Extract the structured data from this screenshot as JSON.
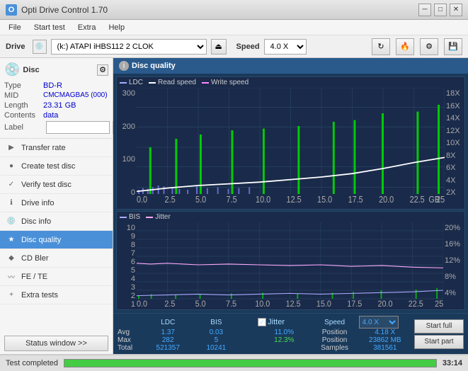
{
  "app": {
    "title": "Opti Drive Control 1.70",
    "titlebar_icon": "O"
  },
  "menubar": {
    "items": [
      "File",
      "Start test",
      "Extra",
      "Help"
    ]
  },
  "drive_toolbar": {
    "label": "Drive",
    "drive_value": "(k:) ATAPI iHBS112  2 CLOK",
    "speed_label": "Speed",
    "speed_value": "4.0 X"
  },
  "disc": {
    "title": "Disc",
    "type_label": "Type",
    "type_value": "BD-R",
    "mid_label": "MID",
    "mid_value": "CMCMAGBA5 (000)",
    "length_label": "Length",
    "length_value": "23.31 GB",
    "contents_label": "Contents",
    "contents_value": "data",
    "label_label": "Label"
  },
  "nav": {
    "items": [
      {
        "id": "transfer-rate",
        "label": "Transfer rate",
        "icon": "▶"
      },
      {
        "id": "create-test-disc",
        "label": "Create test disc",
        "icon": "●"
      },
      {
        "id": "verify-test-disc",
        "label": "Verify test disc",
        "icon": "✓"
      },
      {
        "id": "drive-info",
        "label": "Drive info",
        "icon": "ℹ"
      },
      {
        "id": "disc-info",
        "label": "Disc info",
        "icon": "💿"
      },
      {
        "id": "disc-quality",
        "label": "Disc quality",
        "icon": "★",
        "active": true
      },
      {
        "id": "cd-bler",
        "label": "CD Bler",
        "icon": "◆"
      },
      {
        "id": "fe-te",
        "label": "FE / TE",
        "icon": "~"
      },
      {
        "id": "extra-tests",
        "label": "Extra tests",
        "icon": "+"
      }
    ],
    "status_btn": "Status window >>"
  },
  "chart": {
    "title": "Disc quality",
    "legend_top": {
      "ldc": "LDC",
      "read": "Read speed",
      "write": "Write speed"
    },
    "legend_bottom": {
      "bis": "BIS",
      "jitter": "Jitter"
    },
    "x_labels": [
      "0.0",
      "2.5",
      "5.0",
      "7.5",
      "10.0",
      "12.5",
      "15.0",
      "17.5",
      "20.0",
      "22.5",
      "25.0"
    ],
    "top_y_left": [
      "300",
      "200",
      "100",
      "0"
    ],
    "top_y_right": [
      "18X",
      "16X",
      "14X",
      "12X",
      "10X",
      "8X",
      "6X",
      "4X",
      "2X"
    ],
    "bottom_y_left": [
      "10",
      "9",
      "8",
      "7",
      "6",
      "5",
      "4",
      "3",
      "2",
      "1"
    ],
    "bottom_y_right": [
      "20%",
      "16%",
      "12%",
      "8%",
      "4%"
    ]
  },
  "stats": {
    "headers": [
      "LDC",
      "BIS",
      "",
      "Jitter",
      "Speed",
      ""
    ],
    "rows": [
      {
        "label": "Avg",
        "ldc": "1.37",
        "bis": "0.03",
        "jitter": "11.0%",
        "speed_label": "Position",
        "speed_val": "4.18 X",
        "speed_select": "4.0 X"
      },
      {
        "label": "Max",
        "ldc": "282",
        "bis": "5",
        "jitter": "12.3%",
        "speed_label": "Position",
        "speed_val": "23862 MB"
      },
      {
        "label": "Total",
        "ldc": "521357",
        "bis": "10241",
        "speed_label": "Samples",
        "speed_val": "381561"
      }
    ],
    "jitter_checked": true,
    "jitter_label": "Jitter",
    "speed_val": "4.18 X",
    "speed_select": "4.0 X",
    "position_label": "Position",
    "position_val": "23862 MB",
    "samples_label": "Samples",
    "samples_val": "381561",
    "start_full": "Start full",
    "start_part": "Start part"
  },
  "bottom_bar": {
    "status": "Test completed",
    "progress": 100,
    "time": "33:14"
  }
}
